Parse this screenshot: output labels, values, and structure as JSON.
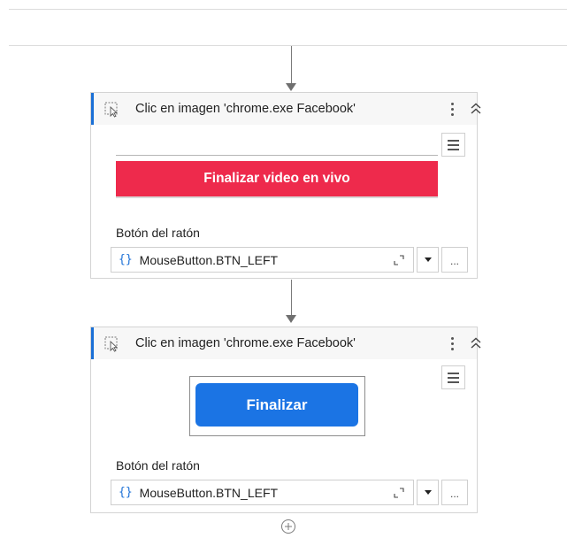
{
  "activities": [
    {
      "title": "Clic en imagen 'chrome.exe  Facebook'",
      "image_button_text": "Finalizar video en vivo",
      "mouse_label": "Botón del ratón",
      "mouse_value": "MouseButton.BTN_LEFT",
      "brace": "{}",
      "ellipsis": "..."
    },
    {
      "title": "Clic en imagen 'chrome.exe  Facebook'",
      "image_button_text": "Finalizar",
      "mouse_label": "Botón del ratón",
      "mouse_value": "MouseButton.BTN_LEFT",
      "brace": "{}",
      "ellipsis": "..."
    }
  ],
  "icons": {
    "header": "click-image-icon",
    "more": "more-vertical-icon",
    "collapse": "collapse-chevron-icon",
    "menu": "hamburger-menu-icon",
    "expand": "expand-editor-icon",
    "dropdown": "dropdown-arrow-icon",
    "add": "add-activity-icon"
  },
  "colors": {
    "accent": "#1a6fd6",
    "facebook_live_end": "#ee2a4c",
    "facebook_blue": "#1b74e4"
  }
}
